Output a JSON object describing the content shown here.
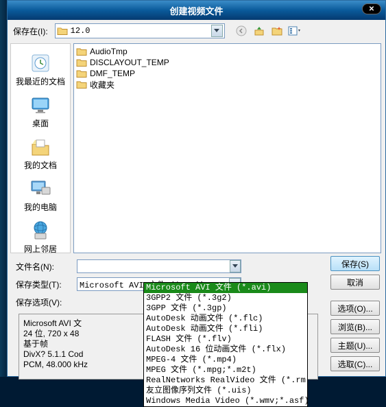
{
  "title": "创建视频文件",
  "toolbar": {
    "save_in_label": "保存在(I):",
    "current_folder": "12.0"
  },
  "sidebar": {
    "items": [
      {
        "label": "我最近的文档"
      },
      {
        "label": "桌面"
      },
      {
        "label": "我的文档"
      },
      {
        "label": "我的电脑"
      },
      {
        "label": "网上邻居"
      }
    ]
  },
  "files": [
    {
      "name": "AudioTmp"
    },
    {
      "name": "DISCLAYOUT_TEMP"
    },
    {
      "name": "DMF_TEMP"
    },
    {
      "name": "收藏夹"
    }
  ],
  "form": {
    "filename_label": "文件名(N):",
    "filename_value": "",
    "savetype_label": "保存类型(T):",
    "savetype_value": "Microsoft AVI 文件 (*.avi)",
    "saveopts_label": "保存选项(V):"
  },
  "buttons": {
    "save": "保存(S)",
    "cancel": "取消",
    "options": "选项(O)...",
    "browse": "浏览(B)...",
    "theme": "主题(U)...",
    "select": "选取(C)..."
  },
  "info": {
    "l1": "Microsoft AVI 文",
    "l2": "24 位, 720 x 48",
    "l3": "基于帧",
    "l4": "DivX? 5.1.1 Cod",
    "l5": "PCM, 48.000 kHz"
  },
  "dropdown": [
    "Microsoft AVI 文件 (*.avi)",
    "3GPP2 文件 (*.3g2)",
    "3GPP 文件 (*.3gp)",
    "AutoDesk 动画文件 (*.flc)",
    "AutoDesk 动画文件 (*.fli)",
    "FLASH 文件 (*.flv)",
    "AutoDesk 16 位动画文件 (*.flx)",
    "MPEG-4 文件 (*.mp4)",
    "MPEG 文件 (*.mpg;*.m2t)",
    "RealNetworks RealVideo 文件 (*.rm)",
    "友立图像序列文件 (*.uis)",
    "Windows Media Video (*.wmv;*.asf)"
  ]
}
